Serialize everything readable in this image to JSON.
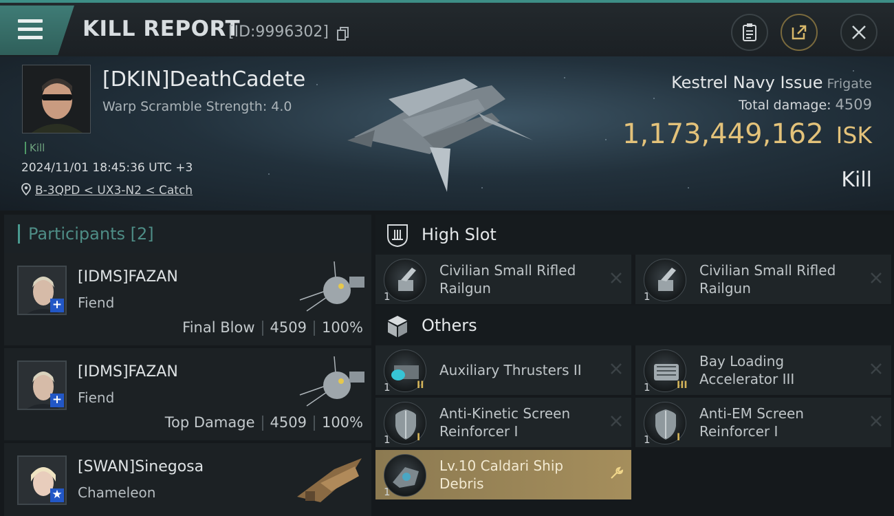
{
  "header": {
    "title": "KILL REPORT",
    "report_id": "[ID:9996302]"
  },
  "victim": {
    "name": "[DKIN]DeathCadete",
    "warp_scramble": "Warp Scramble Strength: 4.0",
    "kill_tag": "Kill",
    "datetime": "2024/11/01 18:45:36 UTC +3",
    "location": "B-3QPD < UX3-N2 < Catch",
    "ship_name": "Kestrel Navy Issue",
    "ship_class": "Frigate",
    "total_damage_label": "Total damage:",
    "total_damage": "4509",
    "isk_value": "1,173,449,162",
    "isk_unit": "ISK",
    "result": "Kill"
  },
  "participants": {
    "label": "Participants",
    "count": "[2]",
    "items": [
      {
        "name": "[IDMS]FAZAN",
        "ship": "Fiend",
        "role": "Final Blow",
        "damage": "4509",
        "percent": "100%",
        "badge": "+"
      },
      {
        "name": "[IDMS]FAZAN",
        "ship": "Fiend",
        "role": "Top Damage",
        "damage": "4509",
        "percent": "100%",
        "badge": "+"
      },
      {
        "name": "[SWAN]Sinegosa",
        "ship": "Chameleon",
        "badge": "★"
      }
    ]
  },
  "fitting": {
    "high_slot": {
      "label": "High Slot",
      "items": [
        {
          "name": "Civilian Small Rifled Railgun",
          "qty": "1"
        },
        {
          "name": "Civilian Small Rifled Railgun",
          "qty": "1"
        }
      ]
    },
    "others": {
      "label": "Others",
      "items": [
        {
          "name": "Auxiliary Thrusters II",
          "qty": "1",
          "meta": "II"
        },
        {
          "name": "Bay Loading Accelerator III",
          "qty": "1",
          "meta": "III"
        },
        {
          "name": "Anti-Kinetic Screen Reinforcer I",
          "qty": "1",
          "meta": "I"
        },
        {
          "name": "Anti-EM Screen Reinforcer I",
          "qty": "1",
          "meta": "I"
        },
        {
          "name": "Lv.10 Caldari Ship Debris",
          "qty": "1"
        }
      ]
    }
  },
  "colors": {
    "accent_teal": "#4a9a90",
    "isk_gold": "#e3c27a",
    "highlight_slot": "#a58e5c"
  },
  "icons": {
    "menu": "hamburger-icon",
    "copy": "copy-icon",
    "clipboard": "clipboard-icon",
    "share": "share-icon",
    "close": "close-icon",
    "location": "location-pin-icon",
    "high_slot": "high-slot-icon",
    "others": "cube-icon",
    "remove": "x-icon",
    "wrench": "wrench-icon"
  }
}
